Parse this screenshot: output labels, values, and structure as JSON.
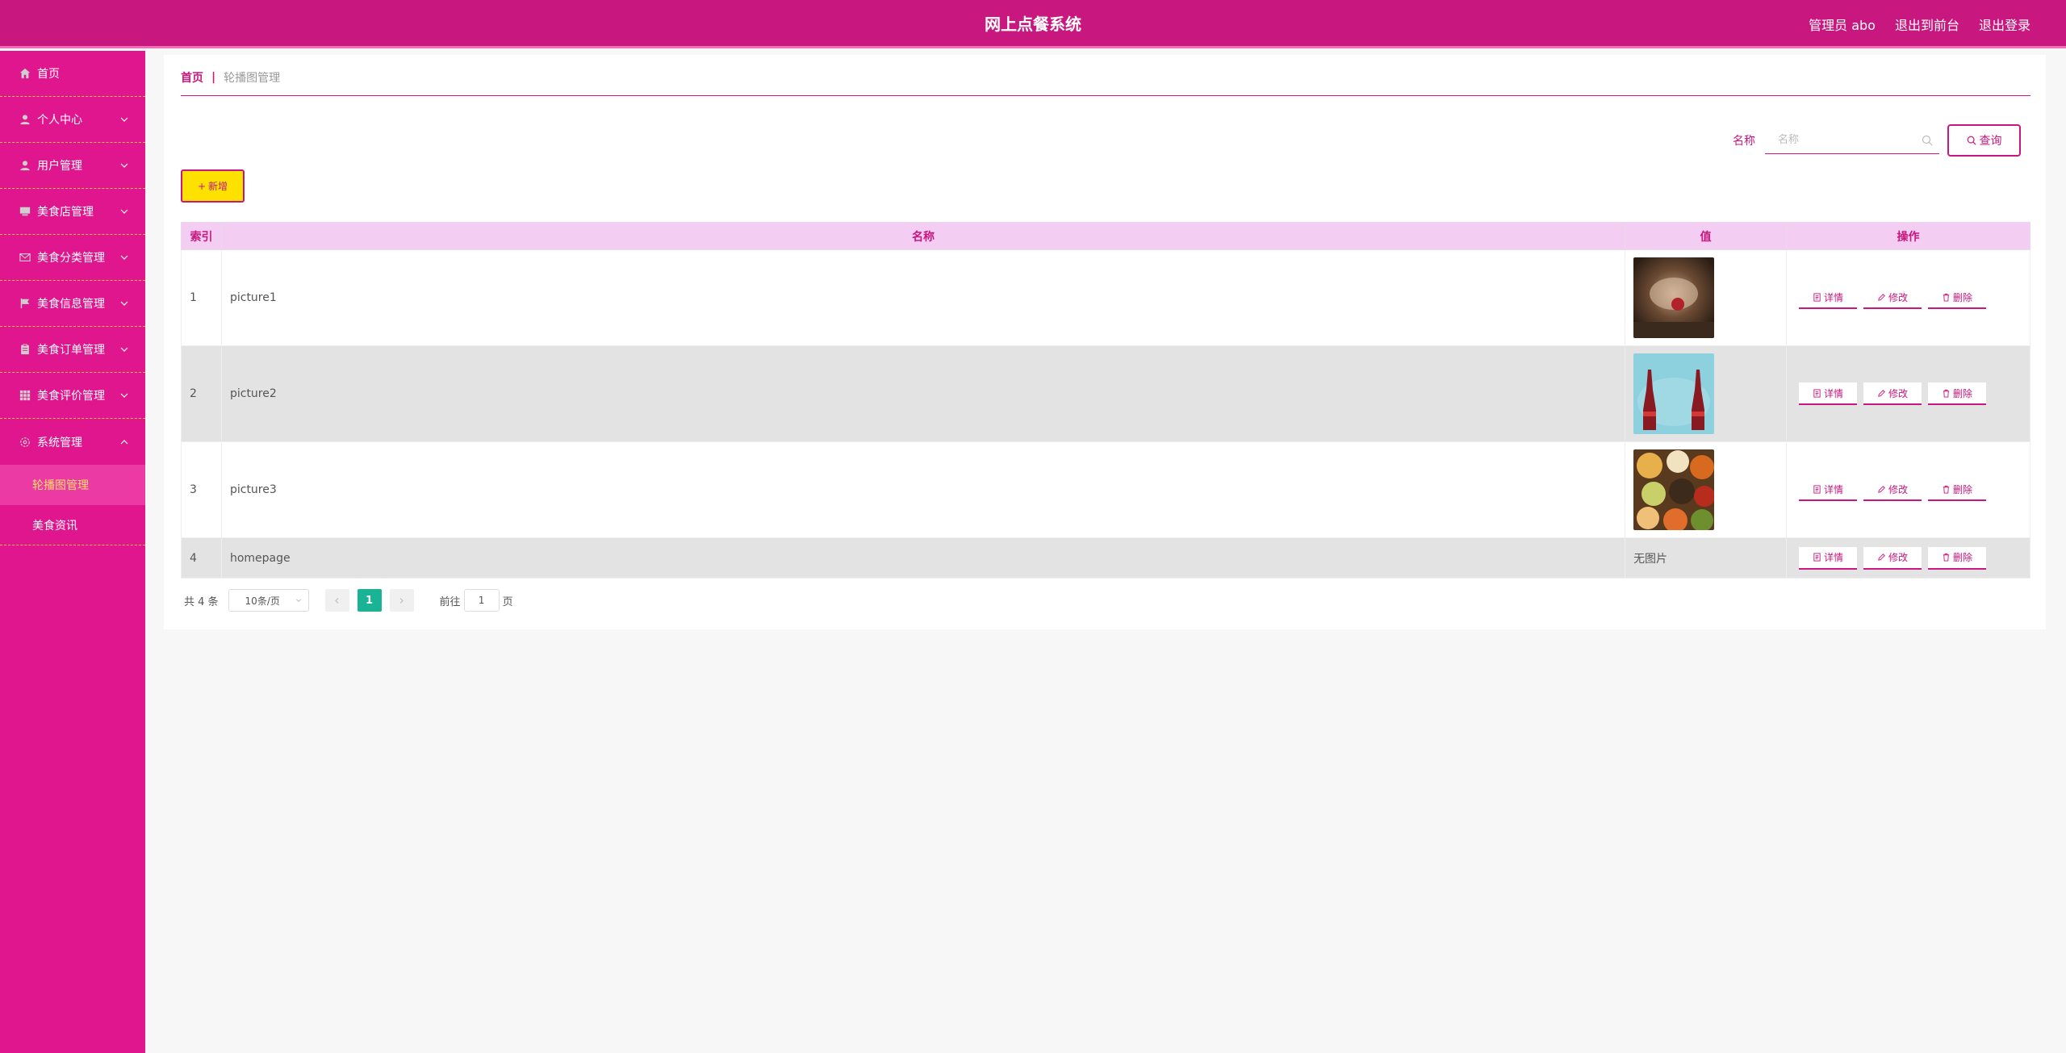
{
  "header": {
    "title": "网上点餐系统",
    "user": "管理员 abo",
    "to_front": "退出到前台",
    "logout": "退出登录"
  },
  "sidebar": {
    "items": [
      {
        "label": "首页",
        "icon": "home-icon"
      },
      {
        "label": "个人中心",
        "icon": "user-icon"
      },
      {
        "label": "用户管理",
        "icon": "user-icon"
      },
      {
        "label": "美食店管理",
        "icon": "shop-icon"
      },
      {
        "label": "美食分类管理",
        "icon": "mail-icon"
      },
      {
        "label": "美食信息管理",
        "icon": "flag-icon"
      },
      {
        "label": "美食订单管理",
        "icon": "clipboard-icon"
      },
      {
        "label": "美食评价管理",
        "icon": "grid-icon"
      },
      {
        "label": "系统管理",
        "icon": "settings-icon"
      }
    ],
    "subitems": [
      {
        "label": "轮播图管理",
        "active": true
      },
      {
        "label": "美食资讯",
        "active": false
      }
    ]
  },
  "breadcrumb": {
    "home": "首页",
    "sep": "|",
    "current": "轮播图管理"
  },
  "search": {
    "label": "名称",
    "placeholder": "名称",
    "button": "查询"
  },
  "toolbar": {
    "add_label": "新增"
  },
  "table": {
    "headers": [
      "索引",
      "名称",
      "值",
      "操作"
    ],
    "rows": [
      {
        "index": "1",
        "name": "picture1",
        "value": "",
        "has_image": true
      },
      {
        "index": "2",
        "name": "picture2",
        "value": "",
        "has_image": true
      },
      {
        "index": "3",
        "name": "picture3",
        "value": "",
        "has_image": true
      },
      {
        "index": "4",
        "name": "homepage",
        "value": "无图片",
        "has_image": false
      }
    ],
    "ops": {
      "detail": "详情",
      "edit": "修改",
      "delete": "删除"
    }
  },
  "pagination": {
    "total": "共 4 条",
    "page_size": "10条/页",
    "current_page": "1",
    "goto_label": "前往",
    "goto_value": "1",
    "page_suffix": "页"
  },
  "colors": {
    "primary": "#c8177e",
    "sidebar": "#e0168e",
    "accent_yellow": "#ffe100",
    "pager_active": "#1ab394"
  }
}
